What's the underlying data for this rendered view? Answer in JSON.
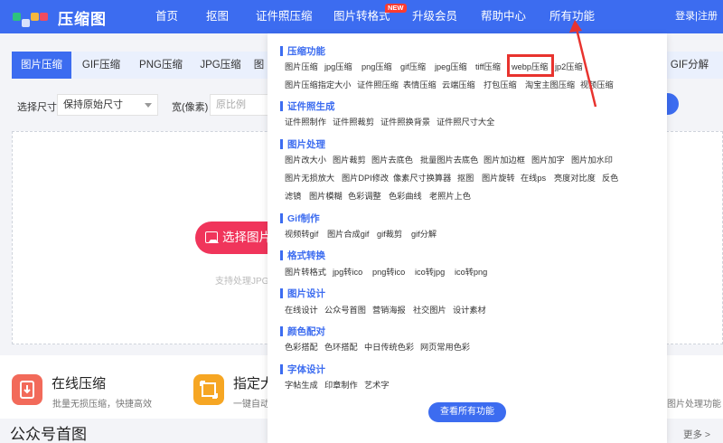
{
  "header": {
    "logo_text": "压缩图",
    "nav": [
      "首页",
      "抠图",
      "证件照压缩",
      "图片转格式",
      "升级会员",
      "帮助中心",
      "所有功能"
    ],
    "new_badge": "NEW",
    "login": "登录|注册",
    "colors": {
      "primary": "#3c6cf0",
      "logo_marks": [
        "#2ec27e",
        "#3c6cf0",
        "#f6b73c",
        "#ef4b5f"
      ]
    }
  },
  "tabs": [
    "图片压缩",
    "GIF压缩",
    "PNG压缩",
    "JPG压缩",
    "图",
    "GIF分解"
  ],
  "size_row": {
    "label": "选择尺寸",
    "select_value": "保持原始尺寸",
    "width_label": "宽(像素)",
    "width_placeholder": "原比例"
  },
  "upload": {
    "button": "选择图片压缩",
    "support": "支持处理JPG、PNG、GIF格式"
  },
  "features": {
    "card1_title": "在线压缩",
    "card1_sub": "批量无损压缩，快捷高效",
    "card2_title": "指定大",
    "card2_sub": "一键自动",
    "card3_sub": "图片处理功能"
  },
  "section": {
    "title": "公众号首图",
    "more": "更多 >"
  },
  "dropdown": {
    "categories": {
      "compress": "压缩功能",
      "idphoto": "证件照生成",
      "image": "图片处理",
      "gif": "Gif制作",
      "format": "格式转换",
      "design": "图片设计",
      "color": "颜色配对",
      "font": "字体设计"
    },
    "compress_row1": [
      "图片压缩",
      "jpg压缩",
      "png压缩",
      "gif压缩",
      "jpeg压缩",
      "tiff压缩",
      "webp压缩",
      "jp2压缩"
    ],
    "compress_row2": [
      "图片压缩指定大小",
      "证件照压缩",
      "表情压缩",
      "云端压缩",
      "打包压缩",
      "淘宝主图压缩",
      "视频压缩"
    ],
    "idphoto_row": [
      "证件照制作",
      "证件照裁剪",
      "证件照换背景",
      "证件照尺寸大全"
    ],
    "image_row1": [
      "图片改大小",
      "图片裁剪",
      "图片去底色",
      "批量图片去底色",
      "图片加边框",
      "图片加字",
      "图片加水印"
    ],
    "image_row2": [
      "图片无损放大",
      "图片DPI修改",
      "像素尺寸换算器",
      "抠图",
      "图片旋转",
      "在线ps",
      "亮度对比度",
      "反色"
    ],
    "image_row3": [
      "滤镜",
      "图片模糊",
      "色彩调整",
      "色彩曲线",
      "老照片上色"
    ],
    "gif_row": [
      "视频转gif",
      "图片合成gif",
      "gif裁剪",
      "gif分解"
    ],
    "format_row": [
      "图片转格式",
      "jpg转ico",
      "png转ico",
      "ico转jpg",
      "ico转png"
    ],
    "design_row": [
      "在线设计",
      "公众号首图",
      "营销海报",
      "社交图片",
      "设计素材"
    ],
    "color_row": [
      "色彩搭配",
      "色环搭配",
      "中日传统色彩",
      "网页常用色彩"
    ],
    "font_row": [
      "字帖生成",
      "印章制作",
      "艺术字"
    ],
    "view_all": "查看所有功能",
    "highlight_color": "#e8332e"
  }
}
